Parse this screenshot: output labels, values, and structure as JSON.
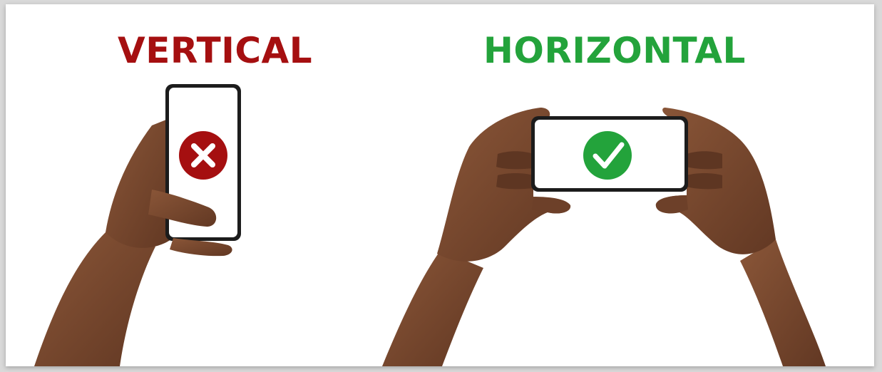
{
  "labels": {
    "vertical": "VERTICAL",
    "horizontal": "HORIZONTAL"
  },
  "colors": {
    "wrong": "#a50f10",
    "right": "#23a33b",
    "skin": "#7a4a30",
    "skin_shadow": "#5e3622",
    "phone_frame": "#1c1c1c"
  },
  "icons": {
    "vertical_phone": "cross-icon",
    "horizontal_phone": "checkmark-icon"
  }
}
